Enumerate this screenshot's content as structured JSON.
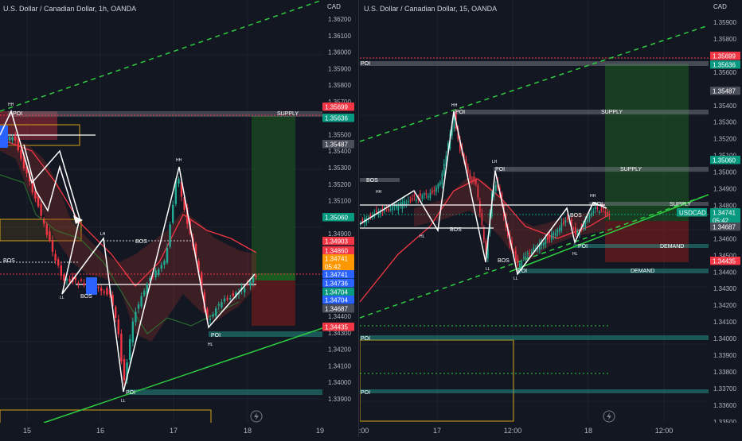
{
  "colors": {
    "bg": "#131722",
    "grid": "#1e222d",
    "up": "#22ab94",
    "down": "#f23645",
    "green_line": "#2ecc40",
    "badge_red": "#f23645",
    "badge_green": "#089981",
    "badge_blue": "#2962ff",
    "badge_orange": "#ff9800",
    "badge_gray": "#4a4e59",
    "supply": "#787b86",
    "demand": "#26a69a",
    "zone_yellow": "#d4a017"
  },
  "left": {
    "title": "U.S. Dollar / Canadian Dollar, 1h, OANDA",
    "currency": "CAD",
    "axis_prices": [
      "1.36200",
      "1.36100",
      "1.36000",
      "1.35900",
      "1.35800",
      "1.35700",
      "1.35600",
      "1.35500",
      "1.35400",
      "1.35300",
      "1.35200",
      "1.35100",
      "1.35000",
      "1.34900",
      "1.34800",
      "1.34700",
      "1.34600",
      "1.34500",
      "1.34400",
      "1.34300",
      "1.34200",
      "1.34100",
      "1.34000",
      "1.33900"
    ],
    "time_labels": [
      "15",
      "16",
      "17",
      "18",
      "19"
    ],
    "badges": [
      {
        "text": "1.35699",
        "kind": "red"
      },
      {
        "text": "1.35636",
        "kind": "green"
      },
      {
        "text": "1.35487",
        "kind": "gray"
      },
      {
        "text": "1.35060",
        "kind": "green"
      },
      {
        "text": "1.34903",
        "kind": "red"
      },
      {
        "text": "1.34860",
        "kind": "red"
      },
      {
        "text": "1.34741",
        "kind": "orange"
      },
      {
        "text": "05:42",
        "kind": "orange"
      },
      {
        "text": "1.34741",
        "kind": "blue"
      },
      {
        "text": "1.34736",
        "kind": "blue"
      },
      {
        "text": "1.34704",
        "kind": "green"
      },
      {
        "text": "1.34704",
        "kind": "blue"
      },
      {
        "text": "1.34687",
        "kind": "gray"
      },
      {
        "text": "1.34435",
        "kind": "red"
      }
    ],
    "labels": {
      "poi_top": "POI",
      "supply": "SUPPLY",
      "bos_a": "BOS",
      "bos_b": "BOS",
      "bos_c": "BOS",
      "poi_mid": "POI",
      "poi_low": "POI",
      "hh_a": "HH",
      "hh_b": "HH",
      "ll_a": "LL",
      "ll_b": "LL",
      "hl": "HL",
      "lh": "LH"
    }
  },
  "right": {
    "title": "U.S. Dollar / Canadian Dollar, 15, OANDA",
    "currency": "CAD",
    "axis_prices": [
      "1.35900",
      "1.35800",
      "1.35700",
      "1.35600",
      "1.35500",
      "1.35400",
      "1.35300",
      "1.35200",
      "1.35100",
      "1.35000",
      "1.34900",
      "1.34800",
      "1.34700",
      "1.34600",
      "1.34500",
      "1.34400",
      "1.34300",
      "1.34200",
      "1.34100",
      "1.34000",
      "1.33900",
      "1.33800",
      "1.33700",
      "1.33600",
      "1.33500"
    ],
    "time_labels": [
      ":00",
      "17",
      "12:00",
      "18",
      "12:00"
    ],
    "badges": [
      {
        "text": "1.35699",
        "kind": "red"
      },
      {
        "text": "1.35636",
        "kind": "green"
      },
      {
        "text": "1.35487",
        "kind": "gray"
      },
      {
        "text": "1.35060",
        "kind": "green"
      },
      {
        "text": "USDCAD",
        "kind": "green"
      },
      {
        "text": "1.34741",
        "kind": "green"
      },
      {
        "text": "05:42",
        "kind": "green"
      },
      {
        "text": "1.34687",
        "kind": "gray"
      },
      {
        "text": "1.34435",
        "kind": "red"
      }
    ],
    "labels": {
      "poi_a": "POI",
      "poi_b": "POI",
      "poi_c": "POI",
      "poi_d": "POI",
      "poi_e": "POI",
      "poi_f": "POI",
      "poi_g": "POI",
      "poi_h": "POI",
      "supply_a": "SUPPLY",
      "supply_b": "SUPPLY",
      "supply_c": "SUPPLY",
      "demand_a": "DEMAND",
      "demand_b": "DEMAND",
      "bos_a": "BOS",
      "bos_b": "BOS",
      "bos_c": "BOS",
      "bos_d": "BOS",
      "hh_a": "HH",
      "hh_b": "HH",
      "hh_c": "HH",
      "lh": "LH",
      "ll_a": "LL",
      "ll_b": "LL",
      "hl_a": "HL",
      "hl_b": "HL"
    }
  },
  "icons": {
    "replay_left": "lightning-icon",
    "replay_right": "lightning-icon"
  }
}
